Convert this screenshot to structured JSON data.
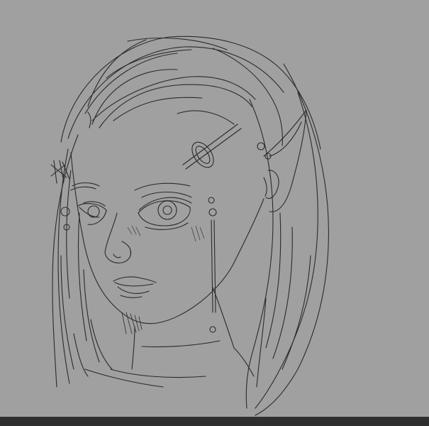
{
  "colors": {
    "canvas_background": "#a0a0a0",
    "line_color": "#2a2a2a",
    "bottom_bar": "#2f2f2f"
  },
  "artwork": {
    "kind": "pencil-line-sketch",
    "subject": "elf-girl-portrait"
  }
}
